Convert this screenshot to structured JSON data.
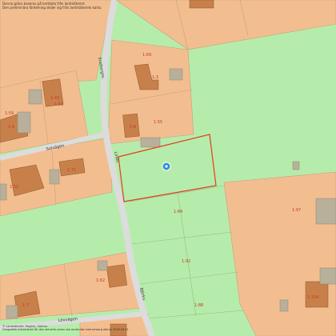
{
  "header": {
    "line1": "Denna gräns baseras på kartdata från lantmäteriet.",
    "line2": "Den preliminära fördelning skiljer sig från lantmäteriets karta."
  },
  "roads": {
    "r1": "Enebergsv.",
    "r2": "Solvägen",
    "r3": "Lindv.",
    "r4": "Lövvägen",
    "r5": "Björkv."
  },
  "parcels": {
    "p1": "1:69",
    "p2": "1:3",
    "p3": "1:61",
    "p4": "1:59",
    "p5": "1:43",
    "p6": "1:55",
    "p7": "1:52",
    "p8": "1:8",
    "p9": "1:4",
    "p10": "1:84",
    "p11": "1:97",
    "p12": "1:92",
    "p13": "1:88",
    "p14": "1:62",
    "p15": "1:7",
    "p16": "1:104",
    "p17": "1:71"
  },
  "footer": {
    "line1": "© Lantmäteriet, Hagesv., Kalmar",
    "line2": "Geografisk information för den aktuella zonen ska användas med omsorg datum 2018-04-01"
  },
  "colors": {
    "parcel": "#f2be90",
    "green": "#b6ecab",
    "road": "#dcdcdc",
    "building": "#c8804a",
    "selection": "#e53b1e"
  },
  "marker": {
    "icon": "location-pin-icon"
  }
}
